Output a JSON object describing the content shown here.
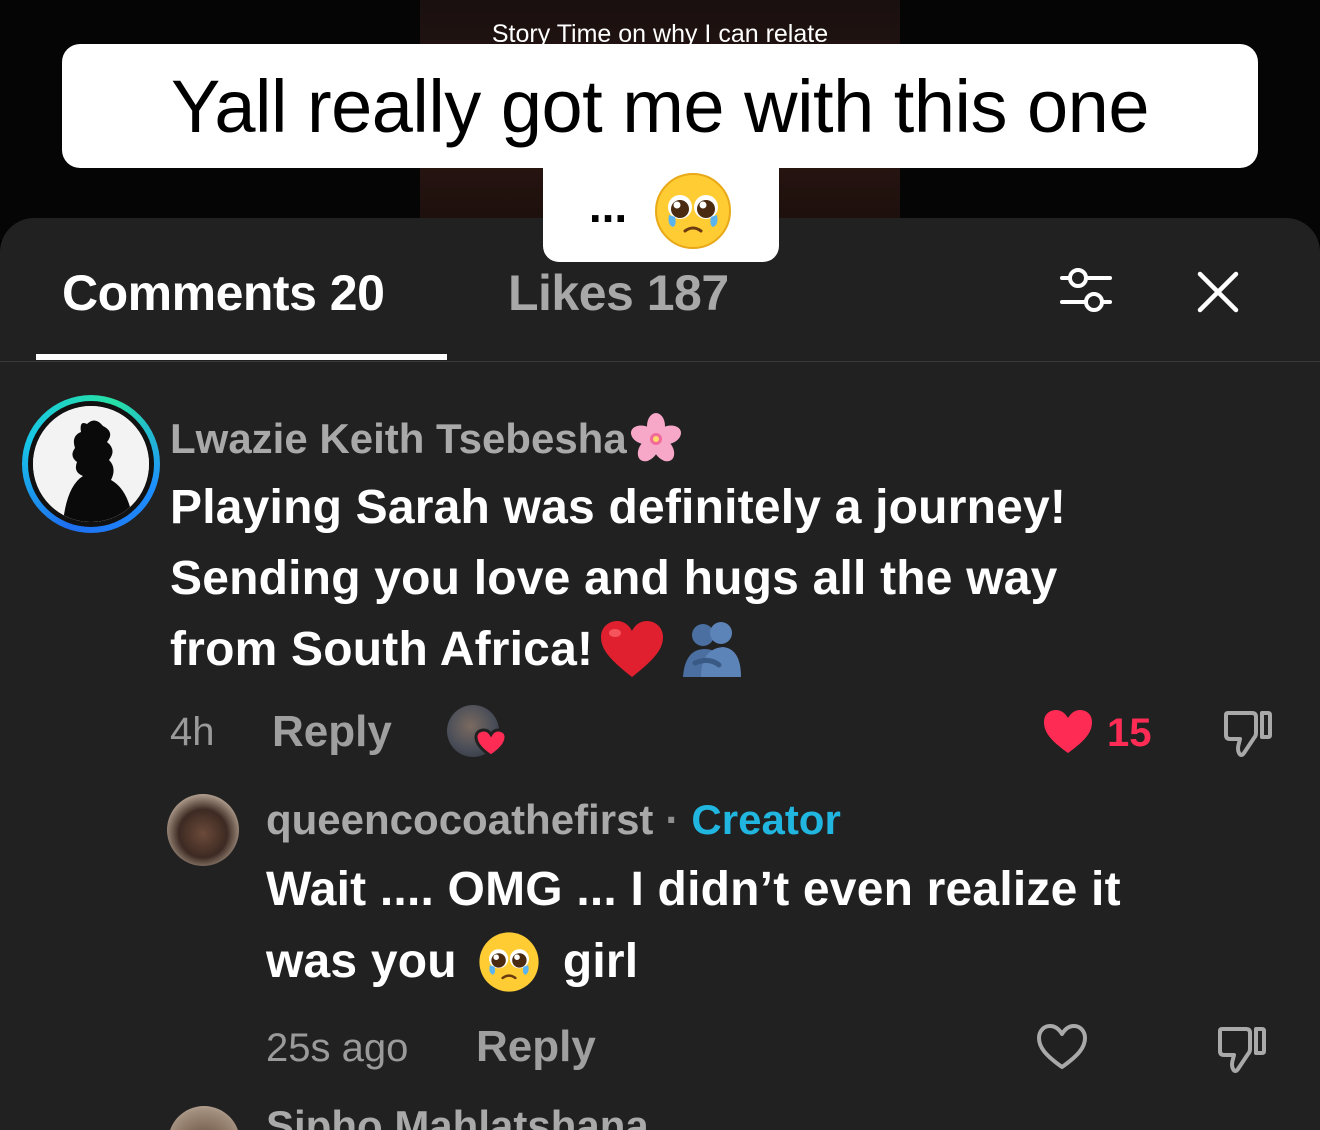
{
  "video": {
    "story_caption": "Story Time on why I can relate",
    "caption_line1": "Yall really got me with this one",
    "caption_line2_dots": "...",
    "caption_emoji": "pleading-face-emoji"
  },
  "panel": {
    "tabs": [
      {
        "label": "Comments 20",
        "active": true
      },
      {
        "label": "Likes 187",
        "active": false
      }
    ],
    "filter_icon": "sliders-icon",
    "close_icon": "close-icon"
  },
  "comments": [
    {
      "username": "Lwazie Keith Tsebesha",
      "username_emoji": "cherry-blossom-emoji",
      "text_lines": [
        "Playing Sarah was definitely a journey!",
        "Sending you love and hugs all the way",
        "from South Africa!"
      ],
      "text_emojis": [
        "red-heart-emoji",
        "people-hugging-emoji"
      ],
      "time": "4h",
      "reply_label": "Reply",
      "liked_by_creator": true,
      "like_count": "15",
      "liked": true
    },
    {
      "username": "queencocoathefirst",
      "separator": "·",
      "badge": "Creator",
      "text_line1": "Wait .... OMG ... I didn’t even realize it",
      "text_line2_a": "was you",
      "text_line2_b": "girl",
      "text_emoji": "pleading-face-emoji",
      "time": "25s ago",
      "reply_label": "Reply",
      "liked": false
    },
    {
      "username": "Sipho Mahlatshana"
    }
  ],
  "colors": {
    "sheet": "#212121",
    "accent_red": "#fe2c55",
    "creator_blue": "#20b6e0",
    "muted": "#a9a9a9"
  }
}
